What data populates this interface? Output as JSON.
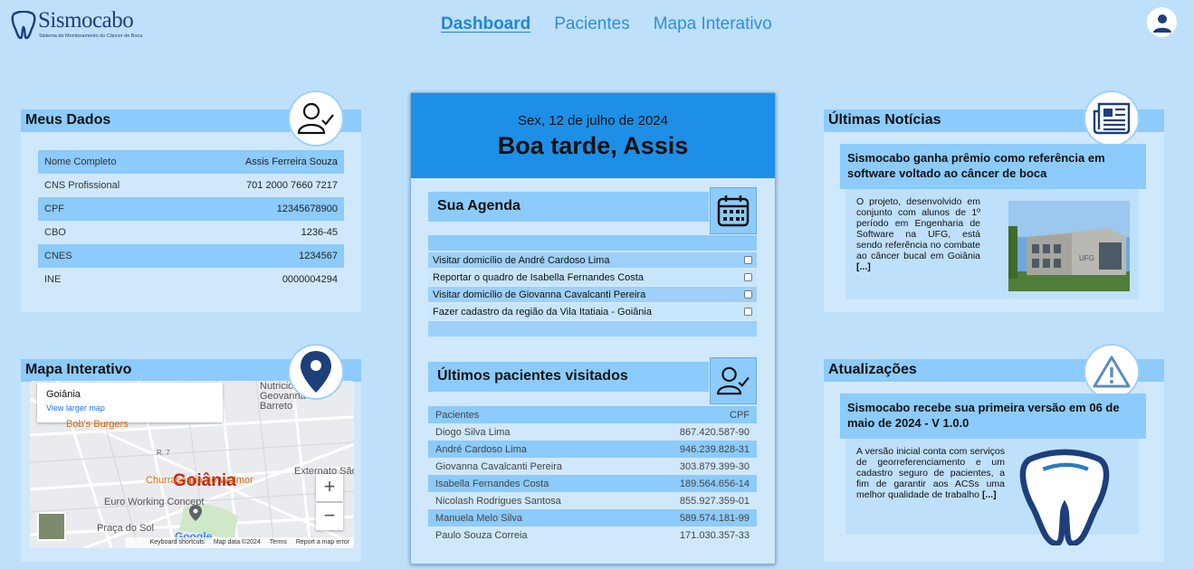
{
  "brand": {
    "name": "Sismocabo",
    "tagline": "Sistema de Monitoramento do Câncer de Boca"
  },
  "nav": {
    "items": [
      "Dashboard",
      "Pacientes",
      "Mapa Interativo"
    ],
    "active": "Dashboard"
  },
  "meus_dados": {
    "title": "Meus Dados",
    "rows": [
      {
        "label": "Nome Completo",
        "value": "Assis Ferreira Souza"
      },
      {
        "label": "CNS Profissional",
        "value": "701 2000 7660 7217"
      },
      {
        "label": "CPF",
        "value": "12345678900"
      },
      {
        "label": "CBO",
        "value": "1236-45"
      },
      {
        "label": "CNES",
        "value": "1234567"
      },
      {
        "label": "INE",
        "value": "0000004294"
      }
    ]
  },
  "mapa": {
    "title": "Mapa Interativo",
    "popup_title": "Goiânia",
    "popup_link": "View larger map",
    "city": "Goiânia",
    "places": [
      "Nutricio Geovanna Barreto",
      "Bob's Burgers",
      "Churrascaria do Walmor",
      "Euro Working Concept",
      "Praça do Sol",
      "Externato São",
      "R. 7"
    ],
    "google": "Google",
    "footer": [
      "Keyboard shortcuts",
      "Map data ©2024",
      "Terms",
      "Report a map error"
    ]
  },
  "center": {
    "date": "Sex, 12 de julho de 2024",
    "greeting": "Boa tarde, Assis",
    "agenda_title": "Sua Agenda",
    "agenda": [
      "Visitar domicílio de André Cardoso Lima",
      "Reportar o quadro de Isabella Fernandes Costa",
      "Visitar domicílio de Giovanna Cavalcanti Pereira",
      "Fazer cadastro da região da Vila Itatiaia - Goiânia"
    ],
    "pacientes_title": "Últimos pacientes visitados",
    "pacientes_header": {
      "name": "Pacientes",
      "cpf": "CPF"
    },
    "pacientes": [
      {
        "name": "Diogo Silva Lima",
        "cpf": "867.420.587-90"
      },
      {
        "name": "André Cardoso Lima",
        "cpf": "946.239.828-31"
      },
      {
        "name": "Giovanna Cavalcanti Pereira",
        "cpf": "303.879.399-30"
      },
      {
        "name": "Isabella Fernandes Costa",
        "cpf": "189.564.656-14"
      },
      {
        "name": "Nicolash Rodrigues Santosa",
        "cpf": "855.927.359-01"
      },
      {
        "name": "Manuela Melo Silva",
        "cpf": "589.574.181-99"
      },
      {
        "name": "Paulo Souza Correia",
        "cpf": "171.030.357-33"
      }
    ]
  },
  "noticias": {
    "title": "Últimas Notícias",
    "headline": "Sismocabo ganha prêmio como referência em software voltado ao câncer de boca",
    "body": "O projeto, desenvolvido em conjunto com alunos de 1º período em Engenharia de Software na UFG, está sendo referência no combate ao câncer bucal em Goiânia",
    "more": "[...]",
    "building_sign": "UFG"
  },
  "atualizacoes": {
    "title": "Atualizações",
    "headline": "Sismocabo recebe sua primeira versão em 06 de maio de 2024 - V 1.0.0",
    "body": "A versão inicial conta com serviços de georreferenciamento e um cadastro seguro de pacientes, a fim de garantir aos ACSs uma melhor qualidade de trabalho",
    "more": "[...]"
  },
  "colors": {
    "background": "#bfe0fb",
    "card": "#cfe8fc",
    "header_blue": "#8ccbfb",
    "accent": "#1e8fe6",
    "brand": "#1d3f7a"
  }
}
